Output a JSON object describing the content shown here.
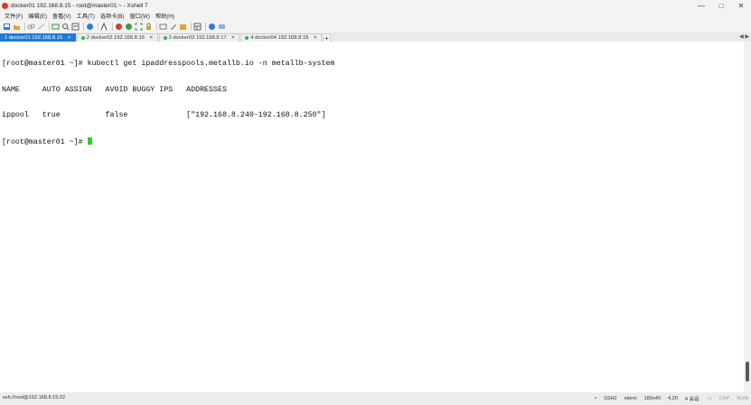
{
  "window": {
    "title": "docker01 192.168.8.15 - root@master01:~ - Xshell 7",
    "buttons": [
      "—",
      "□",
      "✕"
    ]
  },
  "menu": {
    "items": [
      "文件(F)",
      "编辑(E)",
      "查看(V)",
      "工具(T)",
      "选项卡(B)",
      "窗口(W)",
      "帮助(H)"
    ]
  },
  "toolbar": {
    "icons": [
      "new-session-icon",
      "open-folder-icon",
      "link-icon",
      "disconnect-icon",
      "new-tab-icon",
      "search-icon",
      "properties-icon",
      "globe-icon",
      "font-icon",
      "xftp-icon",
      "xagent-icon",
      "fullscreen-icon",
      "lock-icon",
      "keyboard-icon",
      "compose-icon",
      "script-icon",
      "layout-icon",
      "help-icon",
      "chat-icon"
    ]
  },
  "tabs": [
    {
      "label": "1 docker01 192.168.8.15",
      "active": true
    },
    {
      "label": "2 docker02 192.168.8.16",
      "active": false
    },
    {
      "label": "3 docker03 192.168.8.17",
      "active": false
    },
    {
      "label": "4 docker04 192.168.8.18",
      "active": false
    }
  ],
  "tab_add": "+",
  "tab_nav": "◀ ▶",
  "terminal": {
    "lines": [
      "[root@master01 ~]# kubectl get ipaddresspools.metallb.io -n metallb-system",
      "NAME     AUTO ASSIGN   AVOID BUGGY IPS   ADDRESSES",
      "ippool   true          false             [\"192.168.8.240-192.168.8.250\"]"
    ],
    "prompt": "[root@master01 ~]# "
  },
  "status": {
    "connection": "ssh://root@192.168.8.15:22",
    "protocol": "SSH2",
    "term": "xterm",
    "size": "180x40",
    "position": "4,20",
    "sessions": "4 会话",
    "cap": "CAP",
    "num": "NUM"
  }
}
